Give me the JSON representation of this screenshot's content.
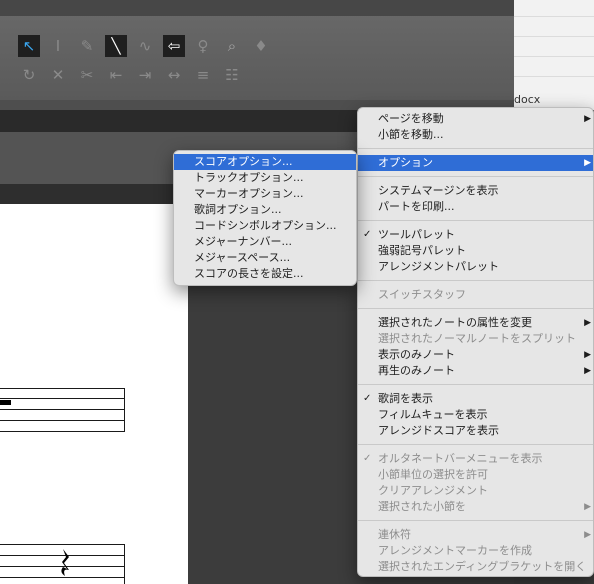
{
  "background_doc_label": "docx",
  "toolbar": {
    "row1": [
      {
        "icon": "arrow-select-icon",
        "glyph": "↖",
        "state": "sel"
      },
      {
        "icon": "text-cursor-icon",
        "glyph": "I",
        "state": "dim"
      },
      {
        "icon": "pencil-icon",
        "glyph": "✎",
        "state": "dim"
      },
      {
        "icon": "line-icon",
        "glyph": "╲",
        "state": "on"
      },
      {
        "icon": "curve-icon",
        "glyph": "∿",
        "state": "dim"
      },
      {
        "icon": "left-arrow-box-icon",
        "glyph": "⇦",
        "state": "on"
      },
      {
        "icon": "brush-icon",
        "glyph": "♀",
        "state": "dim"
      },
      {
        "icon": "magnifier-icon",
        "glyph": "⌕",
        "state": "normal"
      },
      {
        "icon": "tuning-icon",
        "glyph": "♦",
        "state": "dim"
      }
    ],
    "row2": [
      {
        "icon": "rotate-icon",
        "glyph": "↻",
        "state": "dim"
      },
      {
        "icon": "close-x-icon",
        "glyph": "✕",
        "state": "dim"
      },
      {
        "icon": "scissors-icon",
        "glyph": "✂",
        "state": "dim"
      },
      {
        "icon": "insert-left-icon",
        "glyph": "⇤",
        "state": "dim"
      },
      {
        "icon": "insert-right-icon",
        "glyph": "⇥",
        "state": "dim"
      },
      {
        "icon": "expand-icon",
        "glyph": "↔",
        "state": "dim"
      },
      {
        "icon": "split-icon",
        "glyph": "≡",
        "state": "dim"
      },
      {
        "icon": "grid-icon",
        "glyph": "☷",
        "state": "dim"
      }
    ]
  },
  "main_menu": {
    "items": [
      {
        "label": "ページを移動",
        "submenu": true
      },
      {
        "label": "小節を移動..."
      },
      {
        "sep": true
      },
      {
        "label": "オプション",
        "submenu": true,
        "highlighted": true
      },
      {
        "sep": true
      },
      {
        "label": "システムマージンを表示"
      },
      {
        "label": "パートを印刷..."
      },
      {
        "sep": true
      },
      {
        "label": "ツールパレット",
        "checked": true
      },
      {
        "label": "強弱記号パレット"
      },
      {
        "label": "アレンジメントパレット"
      },
      {
        "sep": true
      },
      {
        "label": "スイッチスタッフ",
        "disabled": true
      },
      {
        "sep": true
      },
      {
        "label": "選択されたノートの属性を変更",
        "submenu": true
      },
      {
        "label": "選択されたノーマルノートをスプリット",
        "disabled": true
      },
      {
        "label": "表示のみノート",
        "submenu": true
      },
      {
        "label": "再生のみノート",
        "submenu": true
      },
      {
        "sep": true
      },
      {
        "label": "歌詞を表示",
        "checked": true
      },
      {
        "label": "フィルムキューを表示"
      },
      {
        "label": "アレンジドスコアを表示"
      },
      {
        "sep": true
      },
      {
        "label": "オルタネートバーメニューを表示",
        "checked": true,
        "disabled": true
      },
      {
        "label": "小節単位の選択を許可",
        "disabled": true
      },
      {
        "label": "クリアアレンジメント",
        "disabled": true
      },
      {
        "label": "選択された小節を",
        "submenu": true,
        "disabled": true
      },
      {
        "sep": true
      },
      {
        "label": "連休符",
        "submenu": true,
        "disabled": true
      },
      {
        "label": "アレンジメントマーカーを作成",
        "disabled": true
      },
      {
        "label": "選択されたエンディングブラケットを開く",
        "disabled": true
      }
    ]
  },
  "options_submenu": {
    "items": [
      {
        "label": "スコアオプション...",
        "highlighted": true
      },
      {
        "label": "トラックオプション..."
      },
      {
        "label": "マーカーオプション..."
      },
      {
        "label": "歌詞オプション..."
      },
      {
        "label": "コードシンボルオプション..."
      },
      {
        "label": "メジャーナンバー..."
      },
      {
        "label": "メジャースペース..."
      },
      {
        "label": "スコアの長さを設定..."
      }
    ]
  },
  "icons": {
    "check": "✓",
    "submenu_arrow": "▶",
    "rest": "𝄽"
  }
}
